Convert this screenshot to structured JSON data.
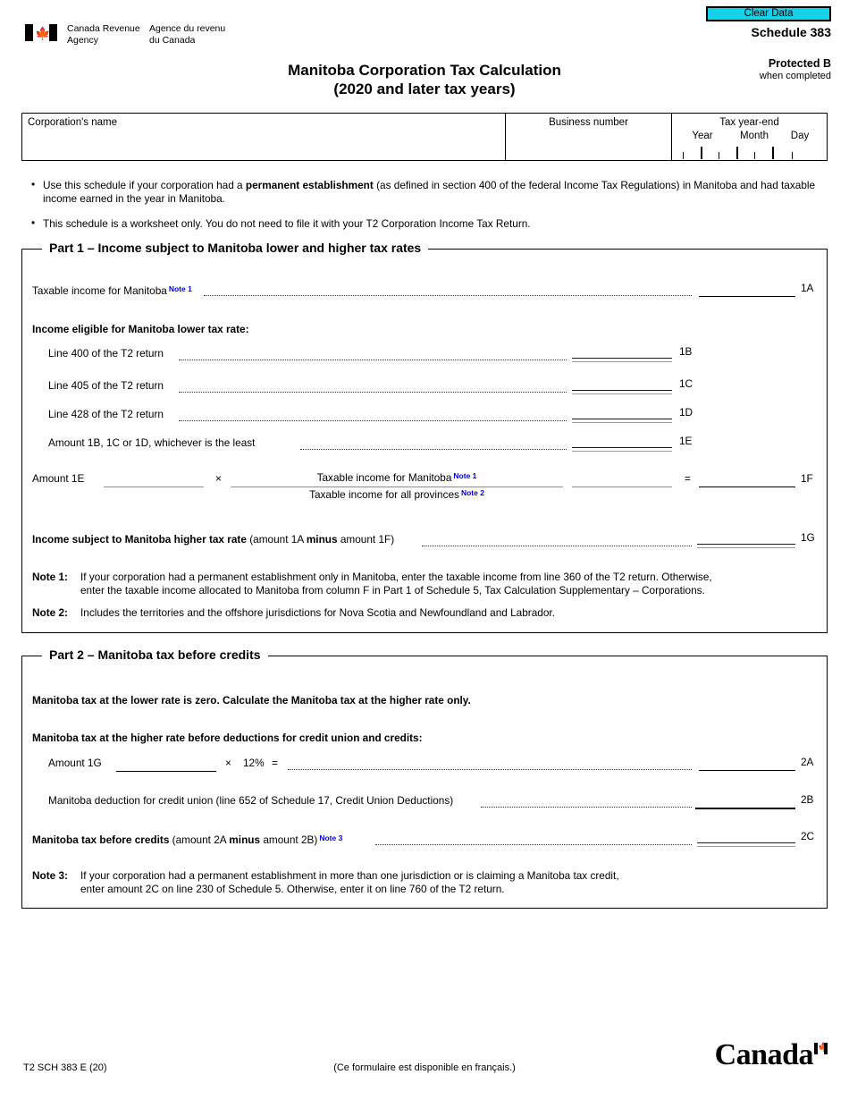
{
  "header": {
    "clear_data_label": "Clear Data",
    "agency_en": "Canada Revenue\nAgency",
    "agency_fr": "Agence du revenu\ndu Canada",
    "schedule_number": "Schedule 383",
    "protected": "Protected B",
    "when_completed": "when completed",
    "title_line1": "Manitoba Corporation Tax Calculation",
    "title_line2": "(2020 and later tax years)"
  },
  "identification": {
    "corporation_name_label": "Corporation's name",
    "corporation_name_value": "",
    "business_number_label": "Business number",
    "business_number_value": "",
    "tax_year_end_label": "Tax year-end",
    "year_label": "Year",
    "month_label": "Month",
    "day_label": "Day",
    "year_value": "",
    "month_value": "",
    "day_value": ""
  },
  "instructions": [
    {
      "part1": "Use this schedule if your corporation had a ",
      "bold": "permanent establishment",
      "part2": " (as defined in section 400 of the federal Income Tax Regulations) in Manitoba and had taxable income earned in the year in Manitoba."
    },
    {
      "part1": "This schedule is a worksheet only. You do not need to file it with your T2 Corporation Income Tax Return.",
      "bold": "",
      "part2": ""
    }
  ],
  "part1": {
    "legend": "Part 1 – Income subject to Manitoba lower and higher tax rates",
    "line_1A": {
      "label": "Taxable income for Manitoba",
      "note": "Note 1",
      "code": "1A",
      "value": ""
    },
    "subheading": "Income eligible for Manitoba lower tax rate:",
    "line_1B": {
      "label": "Line 400 of the T2 return",
      "code": "1B",
      "value": ""
    },
    "line_1C": {
      "label": "Line 405 of the T2 return",
      "code": "1C",
      "value": ""
    },
    "line_1D": {
      "label": "Line 428 of the T2 return",
      "code": "1D",
      "value": ""
    },
    "line_1E": {
      "label": "Amount 1B, 1C or 1D, whichever is the least",
      "code": "1E",
      "value": ""
    },
    "line_1F": {
      "amount_label": "Amount 1E",
      "amount_value": "",
      "multiply": "×",
      "numerator": "Taxable income for Manitoba",
      "numerator_note": "Note 1",
      "denominator": "Taxable income for all provinces",
      "denominator_note": "Note 2",
      "ratio_value": "",
      "equals": "=",
      "code": "1F",
      "value": ""
    },
    "line_1G": {
      "label_bold": "Income subject to Manitoba higher tax rate",
      "label_rest_a": " (amount 1A ",
      "label_minus": "minus",
      "label_rest_b": " amount 1F)",
      "code": "1G",
      "value": ""
    },
    "note1_title": "Note 1:",
    "note1_line1": "If your corporation had a permanent establishment only in Manitoba, enter the taxable income from line 360 of the T2 return. Otherwise,",
    "note1_line2": "enter the taxable income allocated to Manitoba from column F in Part 1 of Schedule 5, Tax Calculation Supplementary – Corporations.",
    "note2_title": "Note 2:",
    "note2_line1": "Includes the territories and the offshore jurisdictions for Nova Scotia and Newfoundland and Labrador."
  },
  "part2": {
    "legend": "Part 2 – Manitoba tax before credits",
    "statement": "Manitoba tax at the lower rate is zero. Calculate the Manitoba tax at the higher rate only.",
    "subheading": "Manitoba tax at the higher rate before deductions for credit union and credits:",
    "line_2A": {
      "amount_label": "Amount 1G",
      "amount_value": "",
      "multiply": "×",
      "rate": "12%",
      "equals": "=",
      "code": "2A",
      "value": ""
    },
    "line_2B": {
      "label": "Manitoba deduction for credit union (line 652 of Schedule 17, Credit Union Deductions)",
      "code": "2B",
      "value": ""
    },
    "line_2C": {
      "label_bold": "Manitoba tax before credits",
      "label_rest_a": " (amount 2A ",
      "label_minus": "minus",
      "label_rest_b": " amount 2B)",
      "note": "Note 3",
      "code": "2C",
      "value": ""
    },
    "note3_title": "Note 3:",
    "note3_line1": "If your corporation had a permanent establishment in more than one jurisdiction or is claiming a Manitoba tax credit,",
    "note3_line2": "enter amount 2C on line 230 of Schedule 5. Otherwise, enter it on line 760 of the T2 return."
  },
  "footer": {
    "form_code": "T2 SCH 383 E (20)",
    "french_note": "(Ce formulaire est disponible en français.)",
    "wordmark": "Canada"
  },
  "colors": {
    "clear_data_bg": "#13d2e8",
    "note_ref": "#0000cc",
    "rule": "#000000"
  }
}
